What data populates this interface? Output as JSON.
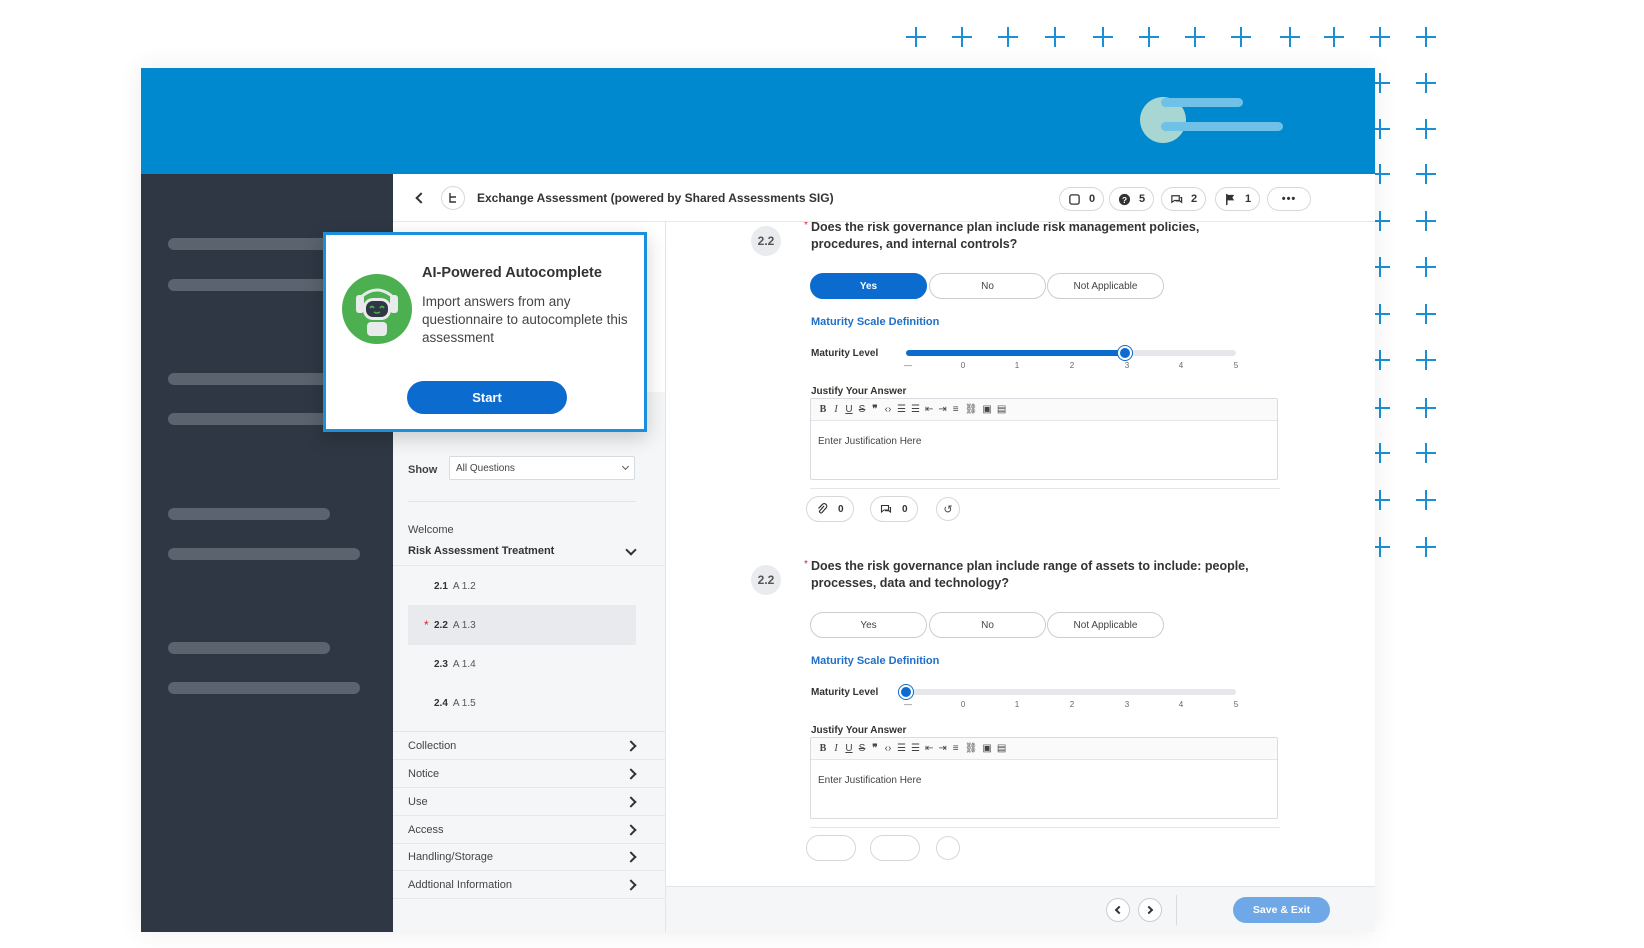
{
  "header": {
    "title": "Exchange Assessment (powered by Shared Assessments SIG)",
    "counters": [
      {
        "icon": "note-icon",
        "count": "0"
      },
      {
        "icon": "help-icon",
        "count": "5"
      },
      {
        "icon": "comments-icon",
        "count": "2"
      },
      {
        "icon": "flag-icon",
        "count": "1"
      }
    ],
    "more_label": "•••"
  },
  "popup": {
    "title": "AI-Powered Autocomplete",
    "description": "Import answers from any questionnaire to autocomplete this assessment",
    "start_label": "Start"
  },
  "nav": {
    "show_label": "Show",
    "show_value": "All Questions",
    "welcome": "Welcome",
    "section": "Risk Assessment Treatment",
    "subitems": [
      {
        "num": "2.1",
        "code": "A 1.2",
        "required": false
      },
      {
        "num": "2.2",
        "code": "A 1.3",
        "required": true
      },
      {
        "num": "2.3",
        "code": "A 1.4",
        "required": false
      },
      {
        "num": "2.4",
        "code": "A 1.5",
        "required": false
      }
    ],
    "sections": [
      "Collection",
      "Notice",
      "Use",
      "Access",
      "Handling/Storage",
      "Addtional Information"
    ]
  },
  "questions": [
    {
      "num": "2.2",
      "text": "Does the risk governance plan include risk management policies, procedures, and internal controls?",
      "options": [
        "Yes",
        "No",
        "Not Applicable"
      ],
      "selected": "Yes",
      "maturity_def": "Maturity Scale Definition",
      "maturity_label": "Maturity Level",
      "maturity_value": 3,
      "ticks": [
        "—",
        "0",
        "1",
        "2",
        "3",
        "4",
        "5"
      ],
      "justify_label": "Justify Your Answer",
      "placeholder": "Enter Justification Here",
      "attachments": "0",
      "comments": "0"
    },
    {
      "num": "2.2",
      "text": "Does the risk governance plan include range of assets to include: people, processes, data and technology?",
      "options": [
        "Yes",
        "No",
        "Not Applicable"
      ],
      "selected": "",
      "maturity_def": "Maturity Scale Definition",
      "maturity_label": "Maturity Level",
      "maturity_value": null,
      "ticks": [
        "—",
        "0",
        "1",
        "2",
        "3",
        "4",
        "5"
      ],
      "justify_label": "Justify Your Answer",
      "placeholder": "Enter Justification Here"
    }
  ],
  "footer": {
    "save_label": "Save & Exit"
  },
  "colors": {
    "brand": "#0089cf",
    "accent": "#0c6bcf",
    "sidebar": "#2e3743",
    "avatar": "#a8d6d3"
  }
}
